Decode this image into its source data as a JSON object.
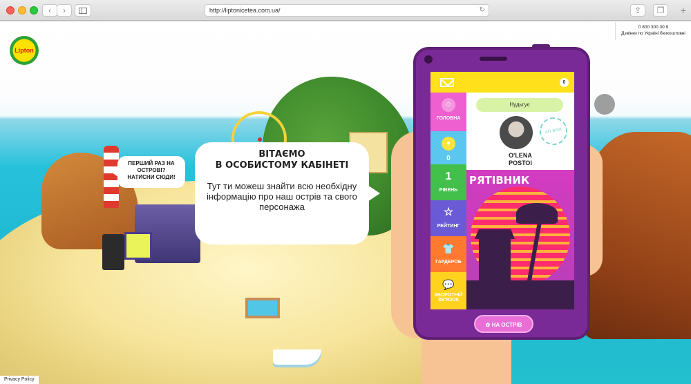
{
  "browser": {
    "url": "http://liptonicetea.com.ua/",
    "reload_icon": "reload-icon",
    "share_icon": "share-icon",
    "tabs_icon": "tabs-icon",
    "new_tab_label": "+",
    "back_label": "‹",
    "forward_label": "›"
  },
  "header": {
    "logo_text": "Lipton",
    "phone_number": "0 800 300 30 9",
    "phone_caption": "Дзвінки по Україні безкоштовні"
  },
  "hint_bubble": {
    "text": "ПЕРШИЙ РАЗ НА ОСТРОВІ? НАТИСНИ СЮДИ!"
  },
  "welcome_bubble": {
    "title": "ВІТАЄМО\nВ ОСОБИСТОМУ КАБІНЕТІ",
    "text": "Тут ти можеш знайти всю необхідну інформацію про наш острів та свого персонажа"
  },
  "phone": {
    "messages_count": "0",
    "status": "Нудьгує",
    "user_name": "O'LENA\nPOSTOI",
    "stamp_text": "ЛІТ ВІЗА",
    "card_title": "РЯТІВНИК",
    "menu": [
      {
        "label": "ГОЛОВНА",
        "icon": "user-icon",
        "value": "",
        "color": "#ee5fd0"
      },
      {
        "label": "0",
        "icon": "coin-icon",
        "value": "",
        "color": "#5cc7ee"
      },
      {
        "label": "РІВЕНЬ",
        "icon": "level-icon",
        "value": "1",
        "color": "#43c04b"
      },
      {
        "label": "РЕЙТИНГ",
        "icon": "star-icon",
        "value": "",
        "color": "#6b5ad6"
      },
      {
        "label": "ГАРДЕРОБ",
        "icon": "shirt-icon",
        "value": "",
        "color": "#ff7a2e"
      },
      {
        "label": "ЗВОРОТНІЙ ЗВ'ЯЗОК",
        "icon": "chat-icon",
        "value": "",
        "color": "#ffd21e"
      }
    ],
    "cta_label": "НА ОСТРІВ"
  },
  "footer": {
    "privacy_label": "Privacy Policy"
  }
}
